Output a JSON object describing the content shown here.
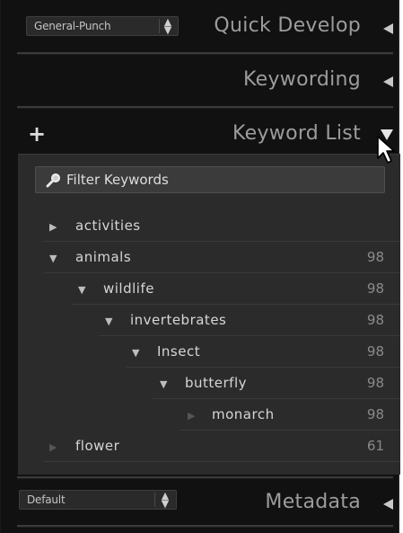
{
  "quick_develop": {
    "preset_value": "General-Punch",
    "title": "Quick Develop"
  },
  "keywording": {
    "title": "Keywording"
  },
  "keyword_list": {
    "add_symbol": "+",
    "title": "Keyword List",
    "filter_placeholder": "Filter Keywords",
    "items": [
      {
        "label": "activities",
        "count": "",
        "expanded": false
      },
      {
        "label": "animals",
        "count": "98",
        "expanded": true
      },
      {
        "label": "wildlife",
        "count": "98",
        "expanded": true
      },
      {
        "label": "invertebrates",
        "count": "98",
        "expanded": true
      },
      {
        "label": "Insect",
        "count": "98",
        "expanded": true
      },
      {
        "label": "butterfly",
        "count": "98",
        "expanded": true
      },
      {
        "label": "monarch",
        "count": "98",
        "expanded": false
      },
      {
        "label": "flower",
        "count": "61",
        "expanded": false
      }
    ]
  },
  "metadata": {
    "preset_value": "Default",
    "title": "Metadata"
  },
  "icons": {
    "collapse": "triangle-left-icon",
    "expand": "triangle-down-icon",
    "search": "magnifier-icon",
    "stepper": "up-down-arrows-icon",
    "cursor": "mouse-pointer-icon"
  },
  "colors": {
    "panel_bg": "#111111",
    "list_bg": "#2b2b2b",
    "header_text": "#9c9c9c",
    "item_text": "#d6d6d6",
    "count_text": "#8a8a8a"
  }
}
